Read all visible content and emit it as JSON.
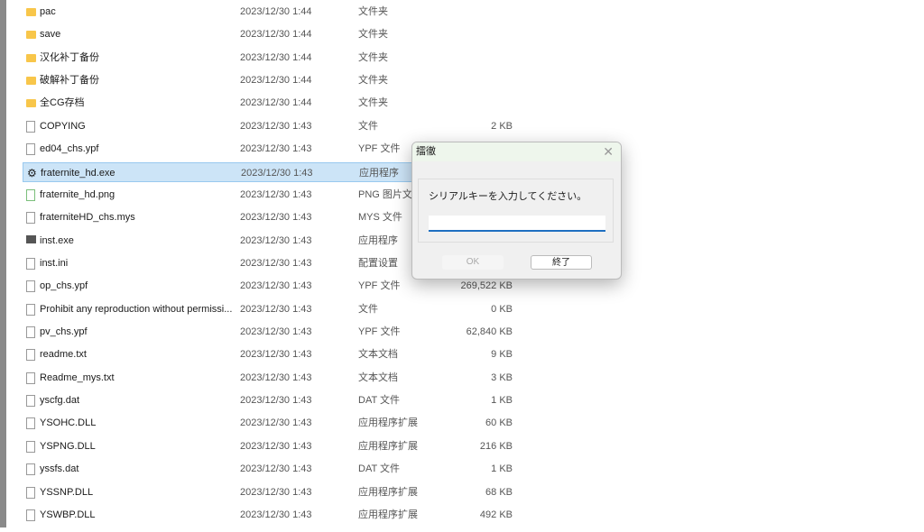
{
  "files": [
    {
      "name": "pac",
      "date": "2023/12/30 1:44",
      "type": "文件夹",
      "size": "",
      "icon": "folder-icon"
    },
    {
      "name": "save",
      "date": "2023/12/30 1:44",
      "type": "文件夹",
      "size": "",
      "icon": "folder-icon"
    },
    {
      "name": "汉化补丁备份",
      "date": "2023/12/30 1:44",
      "type": "文件夹",
      "size": "",
      "icon": "folder-icon"
    },
    {
      "name": "破解补丁备份",
      "date": "2023/12/30 1:44",
      "type": "文件夹",
      "size": "",
      "icon": "folder-icon"
    },
    {
      "name": "全CG存档",
      "date": "2023/12/30 1:44",
      "type": "文件夹",
      "size": "",
      "icon": "folder-icon"
    },
    {
      "name": "COPYING",
      "date": "2023/12/30 1:43",
      "type": "文件",
      "size": "2 KB",
      "icon": "file-icon"
    },
    {
      "name": "ed04_chs.ypf",
      "date": "2023/12/30 1:43",
      "type": "YPF 文件",
      "size": "",
      "icon": "file-icon"
    },
    {
      "name": "fraternite_hd.exe",
      "date": "2023/12/30 1:43",
      "type": "应用程序",
      "size": "",
      "icon": "gear-icon",
      "selected": true
    },
    {
      "name": "fraternite_hd.png",
      "date": "2023/12/30 1:43",
      "type": "PNG 图片文件",
      "size": "",
      "icon": "image-icon"
    },
    {
      "name": "fraterniteHD_chs.mys",
      "date": "2023/12/30 1:43",
      "type": "MYS 文件",
      "size": "",
      "icon": "file-icon"
    },
    {
      "name": "inst.exe",
      "date": "2023/12/30 1:43",
      "type": "应用程序",
      "size": "",
      "icon": "app-icon"
    },
    {
      "name": "inst.ini",
      "date": "2023/12/30 1:43",
      "type": "配置设置",
      "size": "",
      "icon": "settings-file-icon"
    },
    {
      "name": "op_chs.ypf",
      "date": "2023/12/30 1:43",
      "type": "YPF 文件",
      "size": "269,522 KB",
      "icon": "file-icon"
    },
    {
      "name": "Prohibit any reproduction without permissi...",
      "date": "2023/12/30 1:43",
      "type": "文件",
      "size": "0 KB",
      "icon": "file-icon"
    },
    {
      "name": "pv_chs.ypf",
      "date": "2023/12/30 1:43",
      "type": "YPF 文件",
      "size": "62,840 KB",
      "icon": "file-icon"
    },
    {
      "name": "readme.txt",
      "date": "2023/12/30 1:43",
      "type": "文本文档",
      "size": "9 KB",
      "icon": "text-file-icon"
    },
    {
      "name": "Readme_mys.txt",
      "date": "2023/12/30 1:43",
      "type": "文本文档",
      "size": "3 KB",
      "icon": "text-file-icon"
    },
    {
      "name": "yscfg.dat",
      "date": "2023/12/30 1:43",
      "type": "DAT 文件",
      "size": "1 KB",
      "icon": "file-icon"
    },
    {
      "name": "YSOHC.DLL",
      "date": "2023/12/30 1:43",
      "type": "应用程序扩展",
      "size": "60 KB",
      "icon": "file-icon"
    },
    {
      "name": "YSPNG.DLL",
      "date": "2023/12/30 1:43",
      "type": "应用程序扩展",
      "size": "216 KB",
      "icon": "file-icon"
    },
    {
      "name": "yssfs.dat",
      "date": "2023/12/30 1:43",
      "type": "DAT 文件",
      "size": "1 KB",
      "icon": "file-icon"
    },
    {
      "name": "YSSNP.DLL",
      "date": "2023/12/30 1:43",
      "type": "应用程序扩展",
      "size": "68 KB",
      "icon": "file-icon"
    },
    {
      "name": "YSWBP.DLL",
      "date": "2023/12/30 1:43",
      "type": "应用程序扩展",
      "size": "492 KB",
      "icon": "file-icon"
    }
  ],
  "dialog": {
    "title": "擂徹",
    "message": "シリアルキーを入力してください。",
    "input_value": "",
    "ok_label": "OK",
    "exit_label": "終了",
    "close_glyph": "✕"
  }
}
